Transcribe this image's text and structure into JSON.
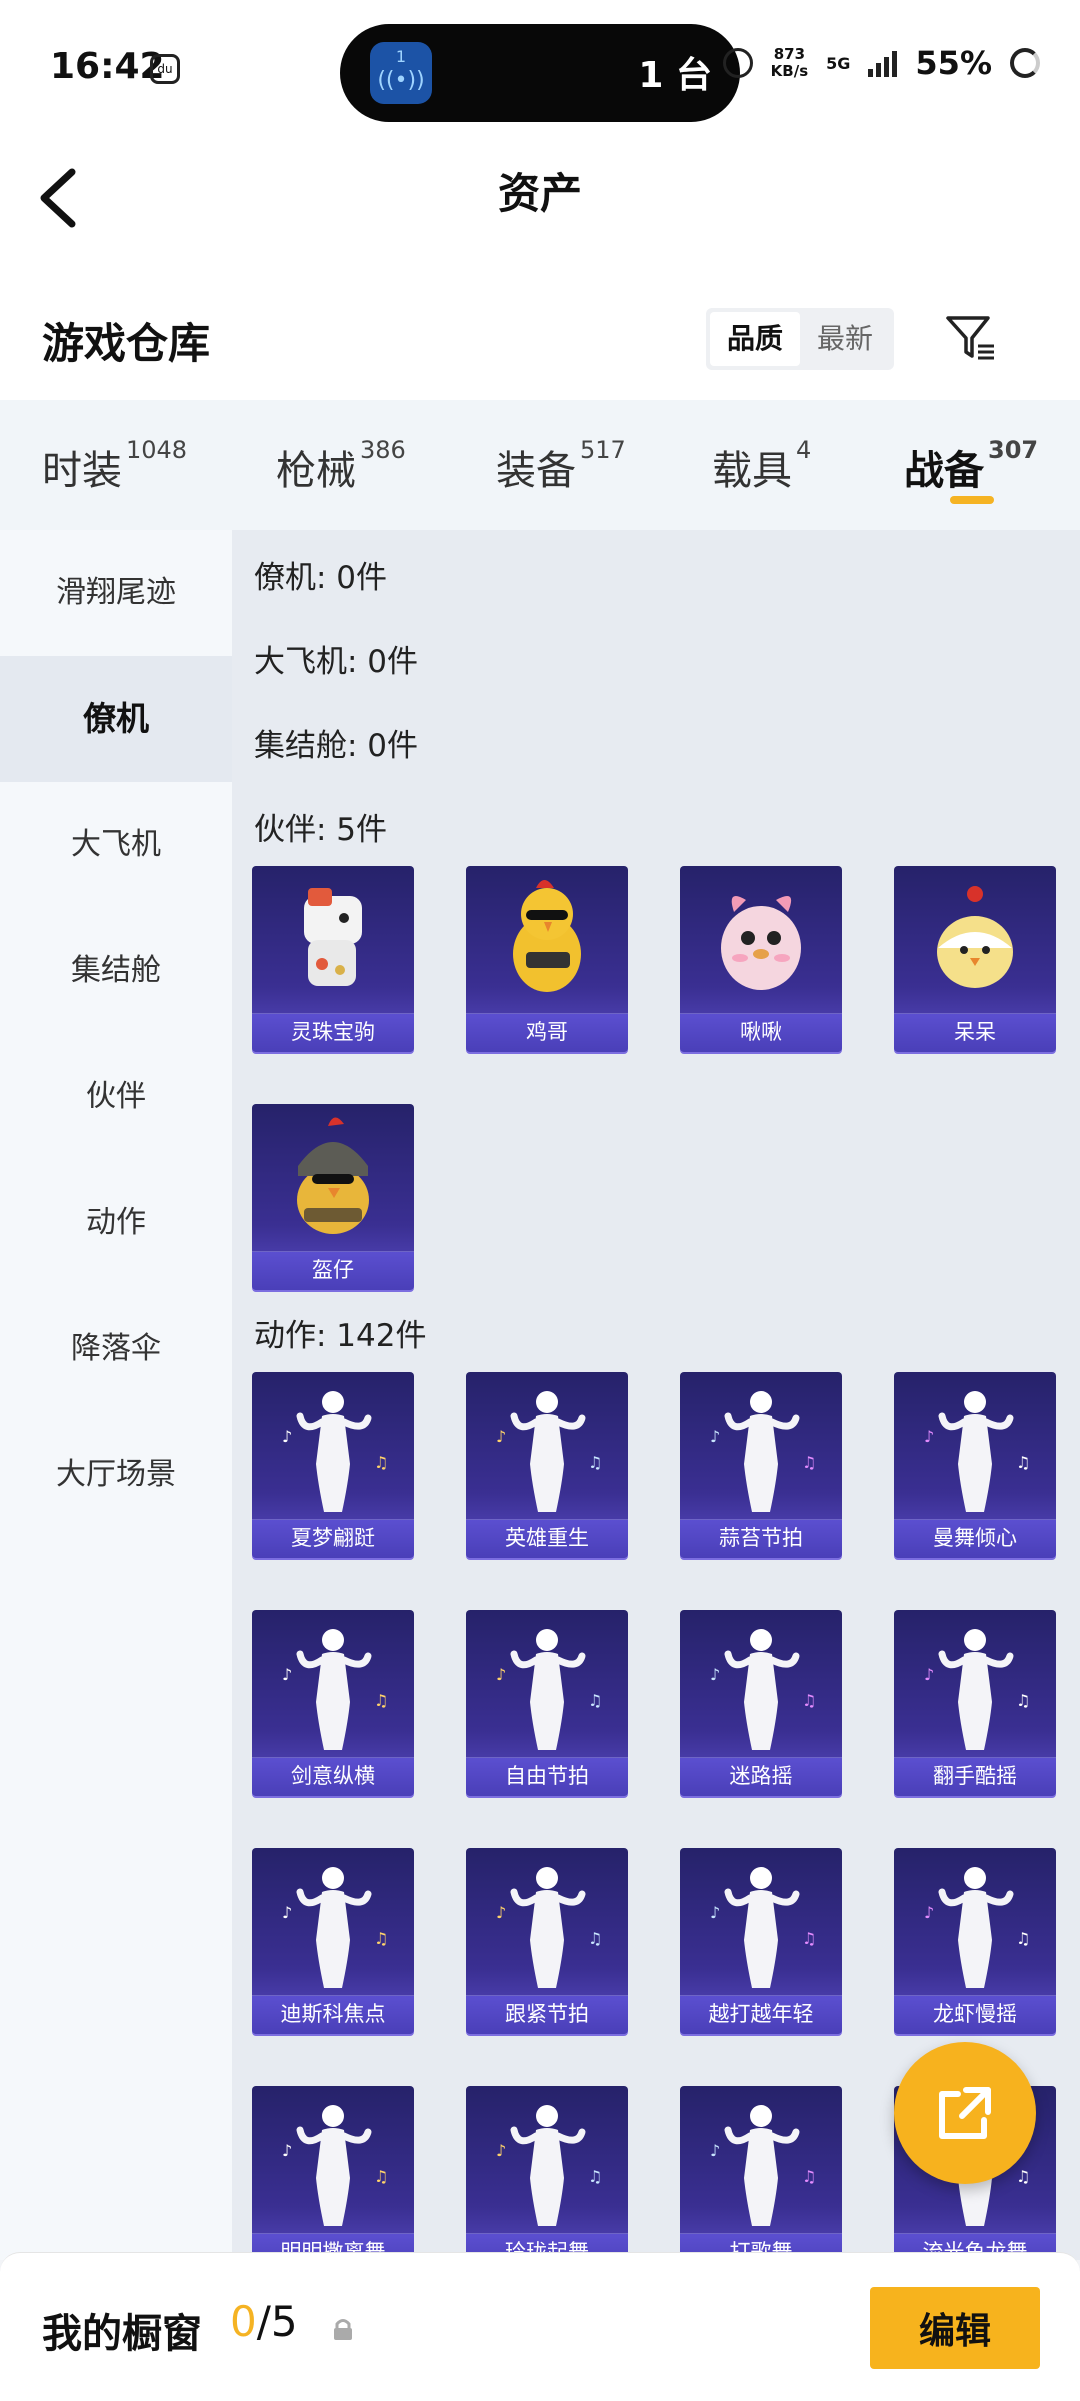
{
  "status_bar": {
    "time": "16:42",
    "island_badge": "1",
    "island_count": "1 台",
    "net_speed_value": "873",
    "net_speed_unit": "KB/s",
    "network": "5G",
    "battery": "55%"
  },
  "header": {
    "title": "资产"
  },
  "warehouse": {
    "title": "游戏仓库",
    "sort_options": [
      "品质",
      "最新"
    ],
    "active_sort": "品质"
  },
  "tabs": [
    {
      "label": "时装",
      "count": "1048"
    },
    {
      "label": "枪械",
      "count": "386"
    },
    {
      "label": "装备",
      "count": "517"
    },
    {
      "label": "载具",
      "count": "4"
    },
    {
      "label": "战备",
      "count": "307",
      "active": true
    }
  ],
  "sidebar": {
    "items": [
      "滑翔尾迹",
      "僚机",
      "大飞机",
      "集结舱",
      "伙伴",
      "动作",
      "降落伞",
      "大厅场景"
    ],
    "active": "僚机"
  },
  "sections": {
    "wingman": "僚机: 0件",
    "big_plane": "大飞机: 0件",
    "rally_pod": "集结舱: 0件",
    "partners": "伙伴: 5件",
    "actions": "动作: 142件"
  },
  "partners": [
    "灵珠宝驹",
    "鸡哥",
    "啾啾",
    "呆呆",
    "盔仔"
  ],
  "actions": [
    "夏梦翩跹",
    "英雄重生",
    "蒜苔节拍",
    "曼舞倾心",
    "剑意纵横",
    "自由节拍",
    "迷路摇",
    "翻手酷摇",
    "迪斯科焦点",
    "跟紧节拍",
    "越打越年轻",
    "龙虾慢摇",
    "明明撒离舞",
    "玲珑起舞",
    "打歌舞",
    "流光鱼龙舞"
  ],
  "bottom": {
    "title": "我的橱窗",
    "current": "0",
    "total": "/5",
    "edit_label": "编辑"
  },
  "colors": {
    "accent": "#f7b31d",
    "card_top": "#26226a",
    "card_bottom": "#5a4cc5"
  }
}
